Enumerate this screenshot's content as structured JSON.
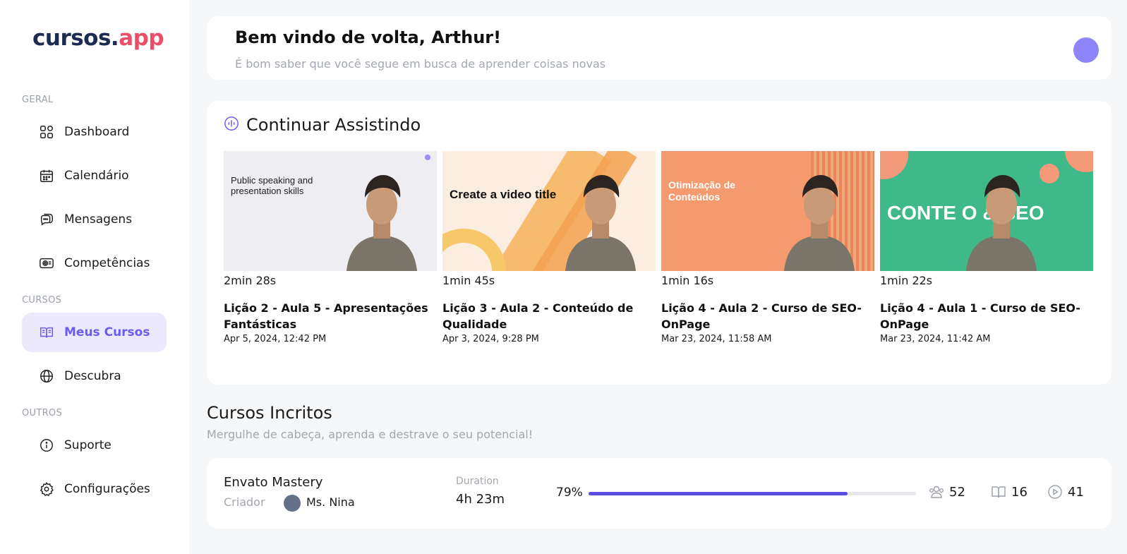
{
  "app": {
    "logo_part1": "cursos.",
    "logo_part2": "app"
  },
  "sidebar": {
    "sections": [
      {
        "label": "GERAL"
      },
      {
        "label": "CURSOS"
      },
      {
        "label": "OUTROS"
      }
    ],
    "items": [
      {
        "label": "Dashboard",
        "icon": "grid-icon"
      },
      {
        "label": "Calendário",
        "icon": "calendar-icon"
      },
      {
        "label": "Mensagens",
        "icon": "chat-icon"
      },
      {
        "label": "Competências",
        "icon": "certificate-icon"
      },
      {
        "label": "Meus Cursos",
        "icon": "book-icon",
        "active": true
      },
      {
        "label": "Descubra",
        "icon": "globe-icon"
      },
      {
        "label": "Suporte",
        "icon": "info-icon"
      },
      {
        "label": "Configurações",
        "icon": "gear-icon"
      }
    ]
  },
  "welcome": {
    "title": "Bem vindo de volta, Arthur!",
    "subtitle": "É bom saber que você segue em busca de aprender coisas novas"
  },
  "continue_watching": {
    "title": "Continuar Assistindo",
    "videos": [
      {
        "duration": "2min 28s",
        "title": "Lição 2 - Aula 5 - Apresentações Fantásticas",
        "date": "Apr 5, 2024, 12:42 PM",
        "thumb_text": "Public speaking and presentation skills",
        "thumb_bg": "#ededf2"
      },
      {
        "duration": "1min 45s",
        "title": "Lição 3 - Aula 2 - Conteúdo de Qualidade",
        "date": "Apr 3, 2024, 9:28 PM",
        "thumb_text": "Create a video title",
        "thumb_bg": "#fbeee0"
      },
      {
        "duration": "1min 16s",
        "title": "Lição 4 - Aula 2 - Curso de SEO-OnPage",
        "date": "Mar 23, 2024, 11:58 AM",
        "thumb_text": "Otimização de Conteúdos",
        "thumb_bg": "#f59a6e"
      },
      {
        "duration": "1min 22s",
        "title": "Lição 4 - Aula 1 - Curso de SEO-OnPage",
        "date": "Mar 23, 2024, 11:42 AM",
        "thumb_text": "CONTE O & SEO",
        "thumb_bg": "#3fb98a"
      }
    ]
  },
  "enrolled": {
    "title": "Cursos Incritos",
    "subtitle": "Mergulhe de cabeça, aprenda e destrave o seu potencial!",
    "courses": [
      {
        "name": "Envato Mastery",
        "creator_label": "Criador",
        "creator_name": "Ms. Nina",
        "duration_label": "Duration",
        "duration": "4h 23m",
        "progress_text": "79%",
        "progress": 0.79,
        "students": "52",
        "lessons": "16",
        "videos": "41"
      }
    ]
  },
  "colors": {
    "accent": "#6b5bef",
    "brand_red": "#ec4e6a",
    "progress": "#5a4fe0"
  }
}
